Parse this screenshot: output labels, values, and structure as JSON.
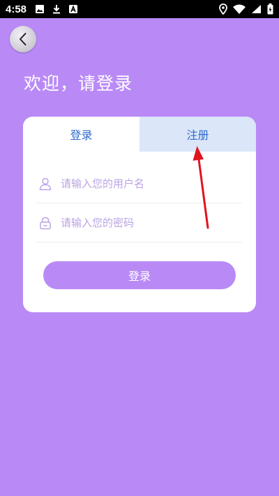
{
  "status_bar": {
    "time": "4:58",
    "left_icons": [
      "image-icon",
      "download-icon",
      "text-a-icon"
    ],
    "right_icons": [
      "location-icon",
      "wifi-icon",
      "signal-icon",
      "battery-charging-icon"
    ]
  },
  "back_button": {
    "icon": "chevron-left-icon"
  },
  "welcome_title": "欢迎，请登录",
  "tabs": [
    {
      "label": "登录",
      "active": true
    },
    {
      "label": "注册",
      "active": false
    }
  ],
  "form": {
    "username": {
      "placeholder": "请输入您的用户名",
      "value": "",
      "icon": "user-icon"
    },
    "password": {
      "placeholder": "请输入您的密码",
      "value": "",
      "icon": "lock-icon"
    }
  },
  "login_button": {
    "label": "登录"
  },
  "colors": {
    "background": "#b98af6",
    "accent_text": "#2d6ccd",
    "tab_inactive_bg": "#dbe6f8",
    "annotation_arrow": "#e0141e"
  }
}
